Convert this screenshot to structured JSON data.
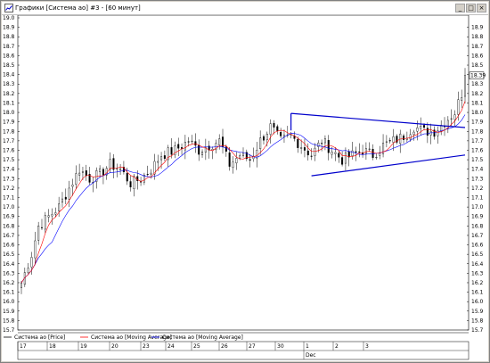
{
  "window": {
    "title": "Графики [Система ао] #3 - [60 минут]",
    "buttons": {
      "minimize": "_",
      "maximize": "□",
      "close": "×"
    }
  },
  "colors": {
    "price": "#000000",
    "ma_red": "#ff0000",
    "ma_blue": "#0000ff",
    "trendline": "#0000cc",
    "price_marker": "#ffffff"
  },
  "legend": [
    {
      "label": "Система ао [Price]",
      "color": "#000000"
    },
    {
      "label": "Система ао [Moving Average]",
      "color": "#ff0000"
    },
    {
      "label": "Система ао [Moving Average]",
      "color": "#0000ff"
    }
  ],
  "chart_data": {
    "type": "candlestick",
    "ylim": [
      15.7,
      19.0
    ],
    "y_ticks": [
      "19.0",
      "18.9",
      "18.8",
      "18.7",
      "18.6",
      "18.5",
      "18.4",
      "18.3",
      "18.2",
      "18.1",
      "18.0",
      "17.9",
      "17.8",
      "17.7",
      "17.6",
      "17.5",
      "17.4",
      "17.3",
      "17.2",
      "17.1",
      "17.0",
      "16.9",
      "16.8",
      "16.7",
      "16.6",
      "16.5",
      "16.4",
      "16.3",
      "16.2",
      "16.1",
      "16.0",
      "15.9",
      "15.8",
      "15.7"
    ],
    "right_y_ticks": [
      "18.9",
      "18.8",
      "18.7",
      "18.6",
      "18.5",
      "18.4",
      "18.3",
      "18.2",
      "18.1",
      "18.0",
      "17.9",
      "17.8",
      "17.7",
      "17.6",
      "17.5",
      "17.4",
      "17.3",
      "17.2",
      "17.1",
      "17.0",
      "16.9",
      "16.8",
      "16.7",
      "16.6",
      "16.5",
      "16.4",
      "16.3",
      "16.2",
      "16.1",
      "16.0",
      "15.9",
      "15.8",
      "15.7"
    ],
    "last_price": "18.39",
    "x_day_labels": [
      "17",
      "18",
      "19",
      "20",
      "23",
      "24",
      "25",
      "26",
      "27",
      "30",
      "1",
      "2",
      "3"
    ],
    "x_month_label": "Dec",
    "num_bars": 131,
    "anchors": [
      [
        0,
        16.2
      ],
      [
        3,
        16.5
      ],
      [
        5,
        16.8
      ],
      [
        8,
        16.9
      ],
      [
        11,
        17.0
      ],
      [
        14,
        17.2
      ],
      [
        17,
        17.4
      ],
      [
        20,
        17.3
      ],
      [
        23,
        17.35
      ],
      [
        26,
        17.45
      ],
      [
        29,
        17.4
      ],
      [
        32,
        17.25
      ],
      [
        35,
        17.3
      ],
      [
        38,
        17.4
      ],
      [
        41,
        17.55
      ],
      [
        45,
        17.6
      ],
      [
        49,
        17.7
      ],
      [
        52,
        17.6
      ],
      [
        55,
        17.65
      ],
      [
        58,
        17.7
      ],
      [
        61,
        17.45
      ],
      [
        64,
        17.55
      ],
      [
        67,
        17.5
      ],
      [
        70,
        17.7
      ],
      [
        73,
        17.85
      ],
      [
        76,
        17.7
      ],
      [
        79,
        17.75
      ],
      [
        82,
        17.65
      ],
      [
        85,
        17.55
      ],
      [
        88,
        17.7
      ],
      [
        91,
        17.6
      ],
      [
        94,
        17.5
      ],
      [
        97,
        17.55
      ],
      [
        100,
        17.6
      ],
      [
        103,
        17.55
      ],
      [
        106,
        17.65
      ],
      [
        109,
        17.7
      ],
      [
        112,
        17.75
      ],
      [
        115,
        17.85
      ],
      [
        118,
        17.8
      ],
      [
        121,
        17.8
      ],
      [
        124,
        17.9
      ],
      [
        127,
        18.0
      ],
      [
        128,
        18.1
      ],
      [
        129,
        18.2
      ],
      [
        130,
        18.39
      ]
    ],
    "trendlines": [
      {
        "x1": 79,
        "y1": 17.99,
        "x2": 130,
        "y2": 17.84
      },
      {
        "x1": 79,
        "y1": 17.99,
        "x2": 79,
        "y2": 17.81
      },
      {
        "x1": 85,
        "y1": 17.33,
        "x2": 130,
        "y2": 17.55
      }
    ],
    "ma_periods": {
      "red": 5,
      "blue": 10
    }
  }
}
